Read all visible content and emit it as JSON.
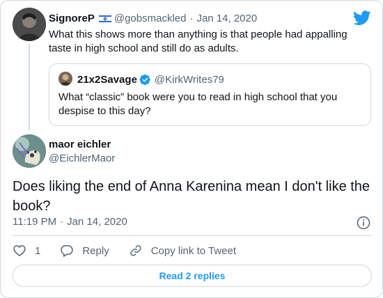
{
  "parent": {
    "display_name": "SignoreP",
    "flag": "Israeli flag emoji",
    "handle": "@gobsmackled",
    "separator": "·",
    "date": "Jan 14, 2020",
    "text": "What this shows more than anything is that people had appalling taste in high school and still do as adults."
  },
  "quoted": {
    "display_name": "21x2Savage",
    "handle": "@KirkWrites79",
    "text": "What “classic” book were you to read in high school that you despise to this day?"
  },
  "main": {
    "display_name": "maor eichler",
    "handle": "@EichlerMaor",
    "text": "Does liking the end of Anna Karenina mean I don't like the book?",
    "time": "11:19 PM",
    "separator": "·",
    "date": "Jan 14, 2020"
  },
  "actions": {
    "like_count": "1",
    "reply_label": "Reply",
    "copy_link_label": "Copy link to Tweet"
  },
  "read_replies_label": "Read 2 replies",
  "colors": {
    "twitter_blue": "#1d9bf0",
    "secondary_text": "#536471",
    "border": "#cfd9de",
    "primary_text": "#0f1419"
  },
  "icons": [
    "twitter-bird-icon",
    "verified-badge-icon",
    "info-icon",
    "heart-icon",
    "reply-bubble-icon",
    "link-icon"
  ]
}
